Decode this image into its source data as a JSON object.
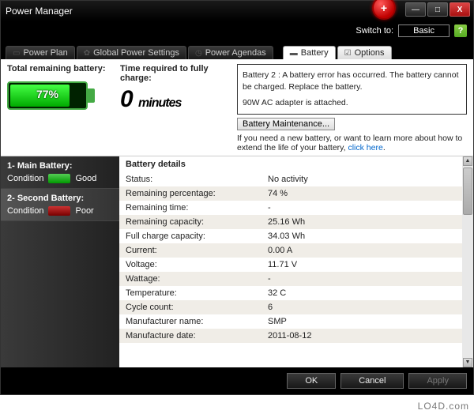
{
  "window": {
    "title": "Power Manager"
  },
  "switch": {
    "label": "Switch to:",
    "button": "Basic"
  },
  "tabs_left": [
    {
      "label": "Power Plan"
    },
    {
      "label": "Global Power Settings"
    },
    {
      "label": "Power Agendas"
    }
  ],
  "tabs_right": [
    {
      "label": "Battery"
    },
    {
      "label": "Options"
    }
  ],
  "summary": {
    "remaining_label": "Total remaining battery:",
    "percent_text": "77%",
    "percent_fill": 77,
    "time_label": "Time required to fully charge:",
    "time_value": "0",
    "time_unit": "minutes"
  },
  "error": {
    "line1": "Battery 2 : A battery error has occurred. The battery cannot be charged. Replace the battery.",
    "line2": "90W AC adapter is attached.",
    "maint_button": "Battery Maintenance...",
    "info_text": "If you need a new battery, or want to learn more about how to extend the life of your battery, ",
    "link_text": "click here"
  },
  "sidebar": [
    {
      "title": "1- Main Battery:",
      "cond_label": "Condition",
      "cond_value": "Good",
      "level": "good"
    },
    {
      "title": "2- Second Battery:",
      "cond_label": "Condition",
      "cond_value": "Poor",
      "level": "poor"
    }
  ],
  "details": {
    "header": "Battery details",
    "rows": [
      {
        "k": "Status:",
        "v": "No activity"
      },
      {
        "k": "Remaining percentage:",
        "v": "74 %"
      },
      {
        "k": "Remaining time:",
        "v": "-"
      },
      {
        "k": "Remaining capacity:",
        "v": "25.16 Wh"
      },
      {
        "k": "Full charge capacity:",
        "v": "34.03 Wh"
      },
      {
        "k": "Current:",
        "v": "0.00 A"
      },
      {
        "k": "Voltage:",
        "v": "11.71 V"
      },
      {
        "k": "Wattage:",
        "v": "-"
      },
      {
        "k": "Temperature:",
        "v": "32 C"
      },
      {
        "k": "Cycle count:",
        "v": "6"
      },
      {
        "k": "Manufacturer name:",
        "v": "SMP"
      },
      {
        "k": "Manufacture date:",
        "v": "2011-08-12"
      }
    ]
  },
  "footer": {
    "ok": "OK",
    "cancel": "Cancel",
    "apply": "Apply"
  },
  "watermark": "LO4D.com"
}
